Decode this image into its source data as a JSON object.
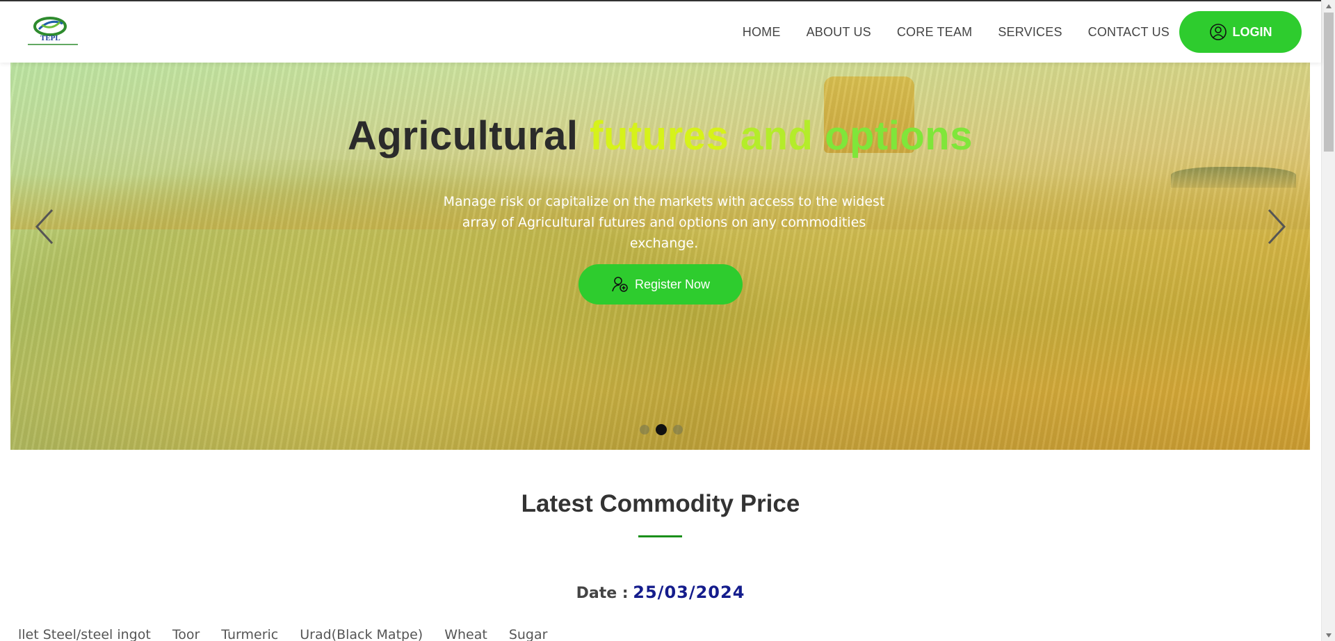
{
  "header": {
    "logo_text": "TEPL",
    "nav": [
      {
        "label": "HOME"
      },
      {
        "label": "ABOUT US"
      },
      {
        "label": "CORE TEAM"
      },
      {
        "label": "SERVICES"
      },
      {
        "label": "CONTACT US"
      }
    ],
    "login_label": "LOGIN",
    "login_icon": "user-circle-icon"
  },
  "hero": {
    "title_word_1": "Agricultural",
    "title_word_2": "futures",
    "title_word_3": "and",
    "title_word_4": "options",
    "description": "Manage risk or capitalize on the markets with access to the widest array of Agricultural futures and options on any commodities exchange.",
    "register_label": "Register Now",
    "register_icon": "user-add-icon",
    "slides_count": 3,
    "active_slide": 2,
    "accent_color": "#2ecc2e"
  },
  "section": {
    "title": "Latest Commodity Price",
    "date_label": "Date :",
    "date_value": "25/03/2024"
  },
  "ticker": {
    "items": [
      "llet Steel/steel ingot",
      "Toor",
      "Turmeric",
      "Urad(Black Matpe)",
      "Wheat",
      "Sugar"
    ]
  }
}
